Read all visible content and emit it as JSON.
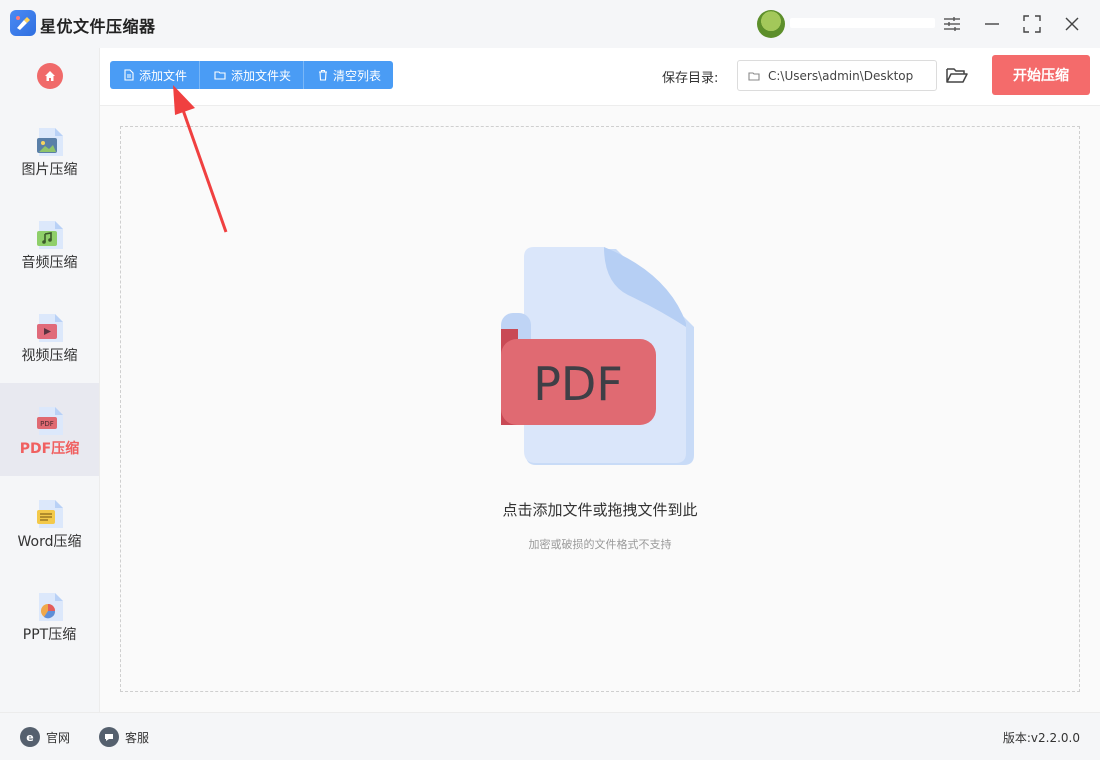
{
  "app": {
    "title": "星优文件压缩器"
  },
  "window_controls": {
    "settings_icon": "sliders-icon",
    "minimize_icon": "minimize-icon",
    "maximize_icon": "maximize-icon",
    "close_icon": "close-icon"
  },
  "sidebar": {
    "home_icon": "home-icon",
    "items": [
      {
        "label": "图片压缩",
        "icon": "image-file-icon",
        "active": false
      },
      {
        "label": "音频压缩",
        "icon": "audio-file-icon",
        "active": false
      },
      {
        "label": "视频压缩",
        "icon": "video-file-icon",
        "active": false
      },
      {
        "label": "PDF压缩",
        "icon": "pdf-file-icon",
        "active": true
      },
      {
        "label": "Word压缩",
        "icon": "word-file-icon",
        "active": false
      },
      {
        "label": "PPT压缩",
        "icon": "ppt-file-icon",
        "active": false
      }
    ]
  },
  "toolbar": {
    "add_file": "添加文件",
    "add_folder": "添加文件夹",
    "clear_list": "清空列表",
    "save_dir_label": "保存目录:",
    "save_path": "C:\\Users\\admin\\Desktop",
    "start_button": "开始压缩"
  },
  "dropzone": {
    "illustration_text": "PDF",
    "title": "点击添加文件或拖拽文件到此",
    "subtitle": "加密或破损的文件格式不支持"
  },
  "footer": {
    "website": "官网",
    "support": "客服",
    "version": "版本:v2.2.0.0"
  },
  "colors": {
    "accent_blue": "#4a9cf5",
    "accent_red": "#f46b6b",
    "active_label": "#f06060",
    "annotation_arrow": "#f04040"
  }
}
